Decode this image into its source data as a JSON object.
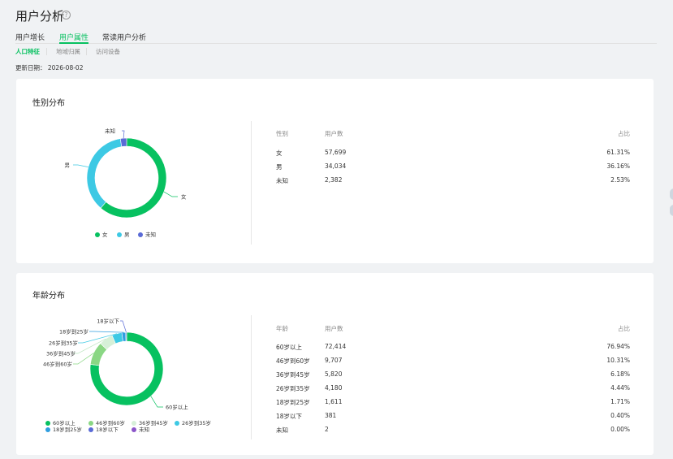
{
  "page": {
    "title": "用户分析",
    "help_icon": "question-circle-icon"
  },
  "tabs": [
    "用户增长",
    "用户属性",
    "常读用户分析"
  ],
  "active_tab": "用户属性",
  "subtabs": [
    "人口特征",
    "地域归属",
    "访问设备"
  ],
  "active_subtab": "人口特征",
  "update_date_label": "更新日期：",
  "update_date": "2026-08-02",
  "gender": {
    "title": "性别分布",
    "headers": [
      "性别",
      "用户数",
      "占比"
    ],
    "rows": [
      {
        "name": "女",
        "count": "57,699",
        "pct": "61.31%"
      },
      {
        "name": "男",
        "count": "34,034",
        "pct": "36.16%"
      },
      {
        "name": "未知",
        "count": "2,382",
        "pct": "2.53%"
      }
    ],
    "legend": [
      "女",
      "男",
      "未知"
    ],
    "colors": [
      "#07c160",
      "#3dc9e4",
      "#5a6bd6"
    ]
  },
  "age": {
    "title": "年龄分布",
    "headers": [
      "年龄",
      "用户数",
      "占比"
    ],
    "rows": [
      {
        "name": "60岁以上",
        "count": "72,414",
        "pct": "76.94%"
      },
      {
        "name": "46岁到60岁",
        "count": "9,707",
        "pct": "10.31%"
      },
      {
        "name": "36岁到45岁",
        "count": "5,820",
        "pct": "6.18%"
      },
      {
        "name": "26岁到35岁",
        "count": "4,180",
        "pct": "4.44%"
      },
      {
        "name": "18岁到25岁",
        "count": "1,611",
        "pct": "1.71%"
      },
      {
        "name": "18岁以下",
        "count": "381",
        "pct": "0.40%"
      },
      {
        "name": "未知",
        "count": "2",
        "pct": "0.00%"
      }
    ],
    "legend": [
      "60岁以上",
      "46岁到60岁",
      "36岁到45岁",
      "26岁到35岁",
      "18岁到25岁",
      "18岁以下",
      "未知"
    ],
    "colors": [
      "#07c160",
      "#8ad784",
      "#d6f0d8",
      "#3dc9e4",
      "#2f9ee0",
      "#5a6bd6",
      "#8b55c9"
    ]
  },
  "chart_data": [
    {
      "type": "pie",
      "categories": [
        "女",
        "男",
        "未知"
      ],
      "values": [
        61.31,
        36.16,
        2.53
      ],
      "legend": "bottom"
    },
    {
      "type": "pie",
      "categories": [
        "60岁以上",
        "46岁到60岁",
        "36岁到45岁",
        "26岁到35岁",
        "18岁到25岁",
        "18岁以下",
        "未知"
      ],
      "values": [
        76.94,
        10.31,
        6.18,
        4.44,
        1.71,
        0.4,
        0.0
      ],
      "legend": "bottom"
    }
  ]
}
